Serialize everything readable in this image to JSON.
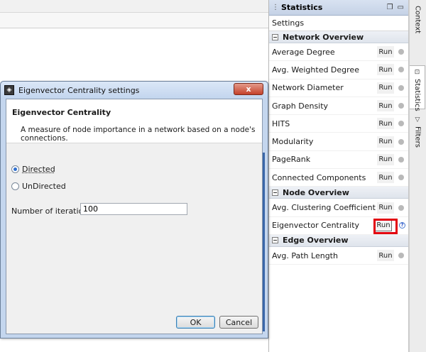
{
  "stats_panel": {
    "title": "Statistics",
    "settings_label": "Settings",
    "sections": [
      {
        "name": "Network Overview",
        "items": [
          {
            "label": "Average Degree",
            "button": "Run"
          },
          {
            "label": "Avg. Weighted Degree",
            "button": "Run"
          },
          {
            "label": "Network Diameter",
            "button": "Run"
          },
          {
            "label": "Graph Density",
            "button": "Run"
          },
          {
            "label": "HITS",
            "button": "Run"
          },
          {
            "label": "Modularity",
            "button": "Run"
          },
          {
            "label": "PageRank",
            "button": "Run"
          },
          {
            "label": "Connected Components",
            "button": "Run"
          }
        ]
      },
      {
        "name": "Node Overview",
        "items": [
          {
            "label": "Avg. Clustering Coefficient",
            "button": "Run"
          },
          {
            "label": "Eigenvector Centrality",
            "button": "Run",
            "highlighted": true
          }
        ]
      },
      {
        "name": "Edge Overview",
        "items": [
          {
            "label": "Avg. Path Length",
            "button": "Run"
          }
        ]
      }
    ]
  },
  "side_tabs": [
    {
      "label": "Context",
      "active": false
    },
    {
      "label": "Statistics",
      "active": true
    },
    {
      "label": "Filters",
      "active": false
    }
  ],
  "dialog": {
    "title": "Eigenvector Centrality settings",
    "close_symbol": "x",
    "header_title": "Eigenvector Centrality",
    "description": "A measure of node importance in a network based on a node's connections.",
    "radios": [
      {
        "label": "Directed",
        "selected": true
      },
      {
        "label": "UnDirected",
        "selected": false
      }
    ],
    "iterations_label": "Number of iterations:",
    "iterations_value": "100",
    "ok_label": "OK",
    "cancel_label": "Cancel"
  },
  "colors": {
    "highlight": "#e2000f",
    "title_gradient_top": "#d8e2f1",
    "dialog_frame": "#c4d6ee"
  }
}
